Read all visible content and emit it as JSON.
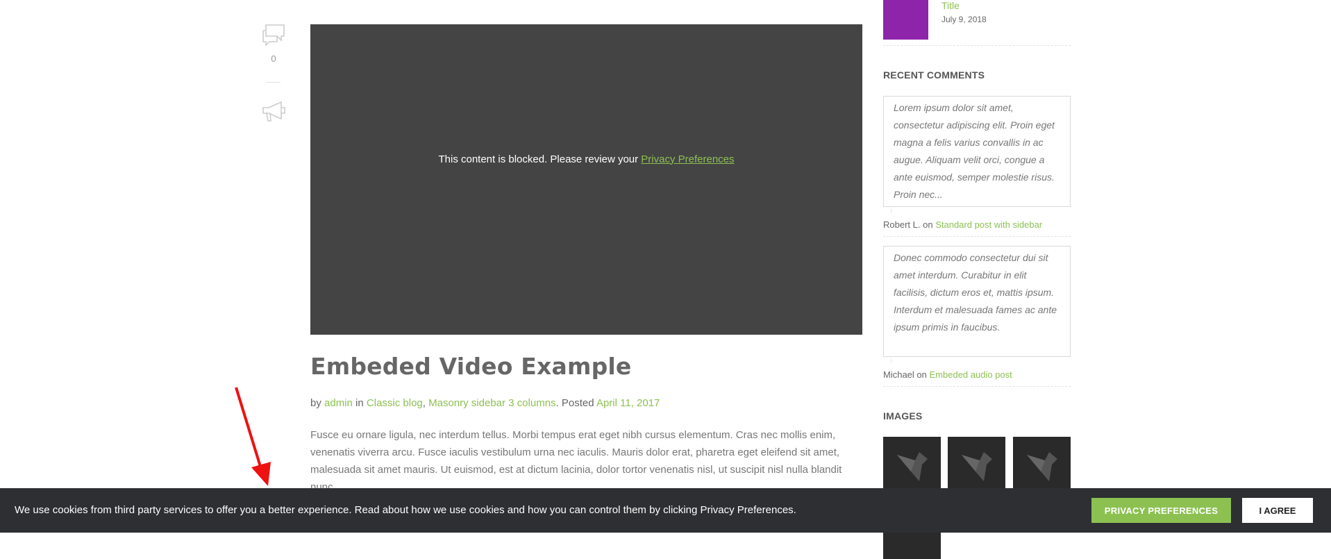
{
  "post": {
    "comment_count": "0",
    "blocked_message": "This content is blocked. Please review your",
    "blocked_link": "Privacy Preferences",
    "title": "Embeded Video Example",
    "meta": {
      "by": "by",
      "author": "admin",
      "in": "in",
      "category1": "Classic blog",
      "comma": ",",
      "category2": "Masonry sidebar 3 columns",
      "posted": ". Posted",
      "date": "April 11, 2017"
    },
    "excerpt": "Fusce eu ornare ligula, nec interdum tellus. Morbi tempus erat eget nibh cursus elementum. Cras nec mollis enim, venenatis viverra arcu. Fusce iaculis vestibulum urna nec iaculis. Mauris dolor erat, pharetra eget eleifend sit amet, malesuada sit amet mauris. Ut euismod, est at dictum lacinia, dolor tortor venenatis nisl, ut suscipit nisl nulla blandit nunc."
  },
  "sidebar": {
    "recent_post": {
      "title": "Title",
      "date": "July 9, 2018",
      "thumb_color": "#8e24aa"
    },
    "recent_comments_title": "RECENT COMMENTS",
    "comments": [
      {
        "text": "Lorem ipsum dolor sit amet, consectetur adipiscing elit. Proin eget magna a felis varius convallis in ac augue. Aliquam velit orci, congue a ante euismod, semper molestie risus. Proin nec...",
        "author": "Robert L.",
        "on": "on",
        "post": "Standard post with sidebar"
      },
      {
        "text": "Donec commodo consectetur dui sit amet interdum. Curabitur in elit facilisis, dictum eros et, mattis ipsum. Interdum et malesuada fames ac ante ipsum primis in faucibus.",
        "author": "Michael",
        "on": "on",
        "post": "Embeded audio post"
      }
    ],
    "images_title": "IMAGES"
  },
  "cookie_bar": {
    "text": "We use cookies from third party services to offer you a better experience. Read about how we use cookies and how you can control them by clicking Privacy Preferences.",
    "privacy_button": "PRIVACY PREFERENCES",
    "agree_button": "I AGREE"
  },
  "colors": {
    "accent": "#8cc152",
    "video_bg": "#444444",
    "cookie_bg": "#2d2f33"
  },
  "icons": [
    "comments-icon",
    "megaphone-icon",
    "bird-logo-icon",
    "arrow-annotation"
  ]
}
